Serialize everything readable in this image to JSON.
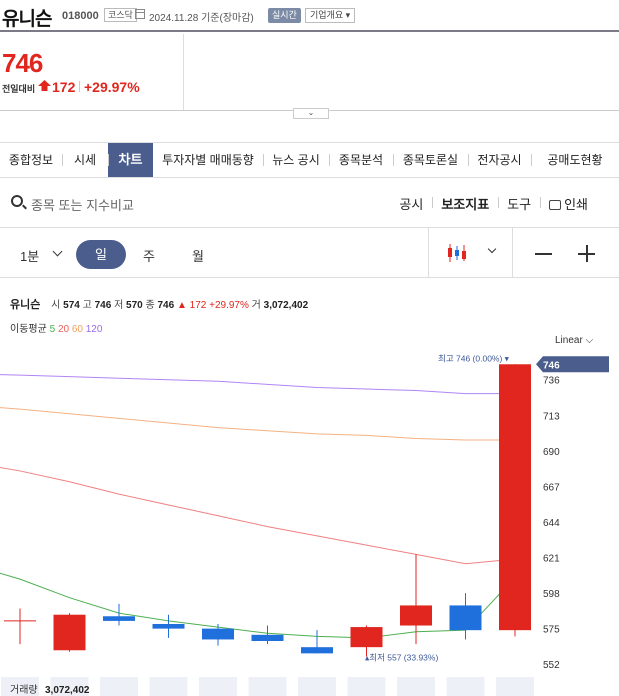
{
  "header": {
    "stock_name": "유니슨",
    "stock_code": "018000",
    "market_badge": "코스닥",
    "date_text": "2024.11.28 기준(장마감)",
    "live_label": "실시간",
    "company_info_label": "기업개요 ▾"
  },
  "price": {
    "current": "746",
    "change_label": "전일대비",
    "change_value": "172",
    "change_pct": "+29.97%",
    "up_color": "#e0261f"
  },
  "expand_toggle": "⌄",
  "tabs": [
    "종합정보",
    "시세",
    "차트",
    "투자자별 매매동향",
    "뉴스 공시",
    "종목분석",
    "종목토론실",
    "전자공시",
    "공매도현황"
  ],
  "active_tab": "차트",
  "search": {
    "placeholder": "종목 또는 지수비교"
  },
  "tools": {
    "disclosure": "공시",
    "indicator": "보조지표",
    "drawing": "도구",
    "print": "인쇄"
  },
  "periods": {
    "minute": "1분",
    "day": "일",
    "week": "주",
    "month": "월"
  },
  "info": {
    "name": "유니슨",
    "open_label": "시",
    "open": "574",
    "high_label": "고",
    "high": "746",
    "low_label": "저",
    "low": "570",
    "close_label": "종",
    "close": "746",
    "change": "▲ 172 +29.97%",
    "volume_label": "거",
    "volume": "3,072,402"
  },
  "ma": {
    "label": "이동평균",
    "p5": "5",
    "p20": "20",
    "p60": "60",
    "p120": "120"
  },
  "scale_label": "Linear ⌵",
  "chart_data": {
    "type": "candlestick",
    "y_ticks": [
      736,
      713,
      690,
      667,
      644,
      621,
      598,
      575,
      552
    ],
    "ylim": [
      545,
      752
    ],
    "current_price_tag": "746",
    "high_annotation": "최고 746 (0.00%)",
    "low_annotation": "최저 557 (33.93%)",
    "candles": [
      {
        "open": 585,
        "high": 588,
        "low": 565,
        "close": 575,
        "color": "#e0261f"
      },
      {
        "open": 584,
        "high": 585,
        "low": 560,
        "close": 561,
        "color": "#e0261f"
      },
      {
        "open": 583,
        "high": 591,
        "low": 577,
        "close": 580,
        "color": "#1f6fdc"
      },
      {
        "open": 578,
        "high": 584,
        "low": 569,
        "close": 575,
        "color": "#1f6fdc"
      },
      {
        "open": 575,
        "high": 578,
        "low": 564,
        "close": 568,
        "color": "#1f6fdc"
      },
      {
        "open": 571,
        "high": 577,
        "low": 565,
        "close": 567,
        "color": "#1f6fdc"
      },
      {
        "open": 563,
        "high": 574,
        "low": 559,
        "close": 559,
        "color": "#1f6fdc"
      },
      {
        "open": 563,
        "high": 577,
        "low": 557,
        "close": 576,
        "color": "#e0261f"
      },
      {
        "open": 577,
        "high": 623,
        "low": 565,
        "close": 590,
        "color": "#e0261f"
      },
      {
        "open": 590,
        "high": 598,
        "low": 568,
        "close": 574,
        "color": "#1f6fdc"
      },
      {
        "open": 574,
        "high": 746,
        "low": 570,
        "close": 746,
        "color": "#e0261f"
      }
    ],
    "series": [
      {
        "name": "5",
        "color": "#4caf50",
        "values": [
          607,
          595,
          585,
          580,
          576,
          572,
          570,
          569,
          573,
          574,
          608
        ]
      },
      {
        "name": "20",
        "color": "#f08080",
        "values": [
          677,
          670,
          662,
          655,
          648,
          641,
          635,
          629,
          623,
          617,
          620
        ]
      },
      {
        "name": "60",
        "color": "#f4b183",
        "values": [
          717,
          714,
          711,
          708,
          705,
          703,
          701,
          700,
          698,
          697,
          697
        ]
      },
      {
        "name": "120",
        "color": "#b085f5",
        "values": [
          739,
          738,
          737,
          736,
          735,
          733,
          731,
          730,
          729,
          727,
          727
        ]
      }
    ],
    "volume_label": "거래량",
    "volume_value": "3,072,402"
  }
}
